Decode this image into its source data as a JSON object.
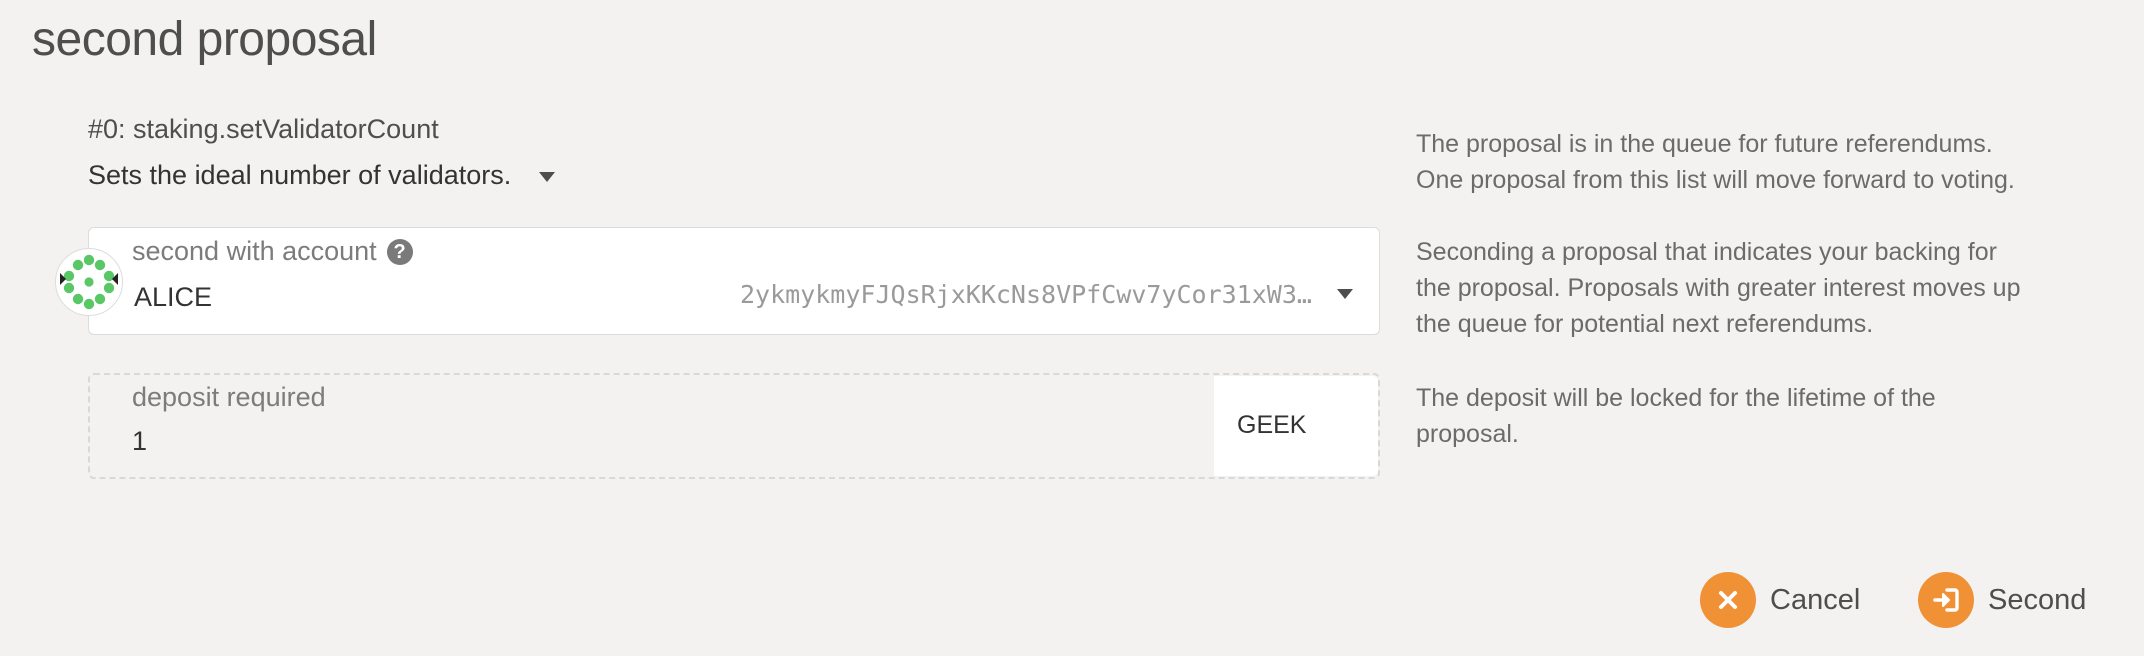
{
  "modal": {
    "title": "second proposal"
  },
  "proposal": {
    "heading": "#0: staking.setValidatorCount",
    "description": "Sets the ideal number of validators."
  },
  "account": {
    "label": "second with account",
    "name": "ALICE",
    "address": "2ykmykmyFJQsRjxKKcNs8VPfCwv7yCor31xW3…"
  },
  "deposit": {
    "label": "deposit required",
    "value": "1",
    "unit": "GEEK"
  },
  "help": {
    "queue_line1": "The proposal is in the queue for future referendums.",
    "queue_line2": "One proposal from this list will move forward to voting.",
    "seconding_line1": "Seconding a proposal that indicates your backing for",
    "seconding_line2": "the proposal. Proposals with greater interest moves up",
    "seconding_line3": "the queue for potential next referendums.",
    "deposit_line1": "The deposit will be locked for the lifetime of the",
    "deposit_line2": "proposal."
  },
  "actions": {
    "cancel_label": "Cancel",
    "second_label": "Second"
  },
  "colors": {
    "accent": "#f19135",
    "identicon_green": "#5ac766",
    "background": "#f3f2f1"
  },
  "icons": {
    "help": "question-circle-icon",
    "cancel": "close-icon",
    "second": "sign-in-icon",
    "dropdown": "caret-down-icon"
  }
}
